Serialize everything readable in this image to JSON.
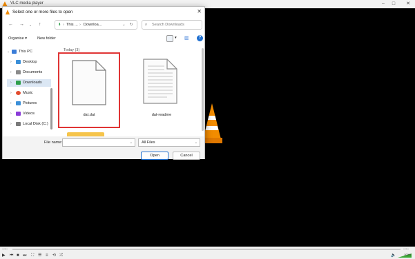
{
  "vlc": {
    "title": "VLC media player",
    "time_left": "--:--",
    "time_right": "--:--",
    "volume": "100%"
  },
  "dialog": {
    "title": "Select one or more files to open",
    "breadcrumb": [
      "This ...",
      "Downloa..."
    ],
    "search_placeholder": "Search Downloads",
    "organise": "Organise",
    "new_folder": "New folder",
    "tree": [
      {
        "label": "This PC",
        "icon": "this-pc-icon",
        "color": "#3b7dd8"
      },
      {
        "label": "Desktop",
        "icon": "desktop-icon",
        "color": "#3b8fd8"
      },
      {
        "label": "Documents",
        "icon": "documents-icon",
        "color": "#8a8a8a"
      },
      {
        "label": "Downloads",
        "icon": "downloads-icon",
        "color": "#2e9e4b"
      },
      {
        "label": "Music",
        "icon": "music-icon",
        "color": "#e24c2e"
      },
      {
        "label": "Pictures",
        "icon": "pictures-icon",
        "color": "#3b8fd8"
      },
      {
        "label": "Videos",
        "icon": "videos-icon",
        "color": "#8a3bd8"
      },
      {
        "label": "Local Disk (C:)",
        "icon": "disk-icon",
        "color": "#7a7a7a"
      }
    ],
    "group_header": "Today (3)",
    "files": [
      {
        "name": "dat.dat"
      },
      {
        "name": "dat-readme"
      }
    ],
    "file_name_label": "File name:",
    "file_name_value": "",
    "filter": "All Files",
    "open_button": "Open",
    "cancel_button": "Cancel"
  }
}
